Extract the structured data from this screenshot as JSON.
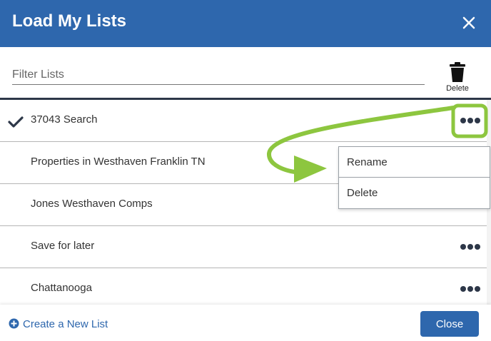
{
  "dialog": {
    "title": "Load My Lists"
  },
  "filter": {
    "placeholder": "Filter Lists"
  },
  "toolbar": {
    "delete_label": "Delete"
  },
  "lists": [
    {
      "label": "37043 Search",
      "selected": true
    },
    {
      "label": "Properties in Westhaven Franklin TN",
      "selected": false
    },
    {
      "label": "Jones Westhaven Comps",
      "selected": false
    },
    {
      "label": "Save for later",
      "selected": false
    },
    {
      "label": "Chattanooga",
      "selected": false
    }
  ],
  "context_menu": {
    "items": [
      "Rename",
      "Delete"
    ]
  },
  "footer": {
    "create_label": "Create a New List",
    "close_label": "Close"
  },
  "colors": {
    "header": "#2e67ad",
    "annotation": "#8dc63f",
    "text": "#333333"
  }
}
